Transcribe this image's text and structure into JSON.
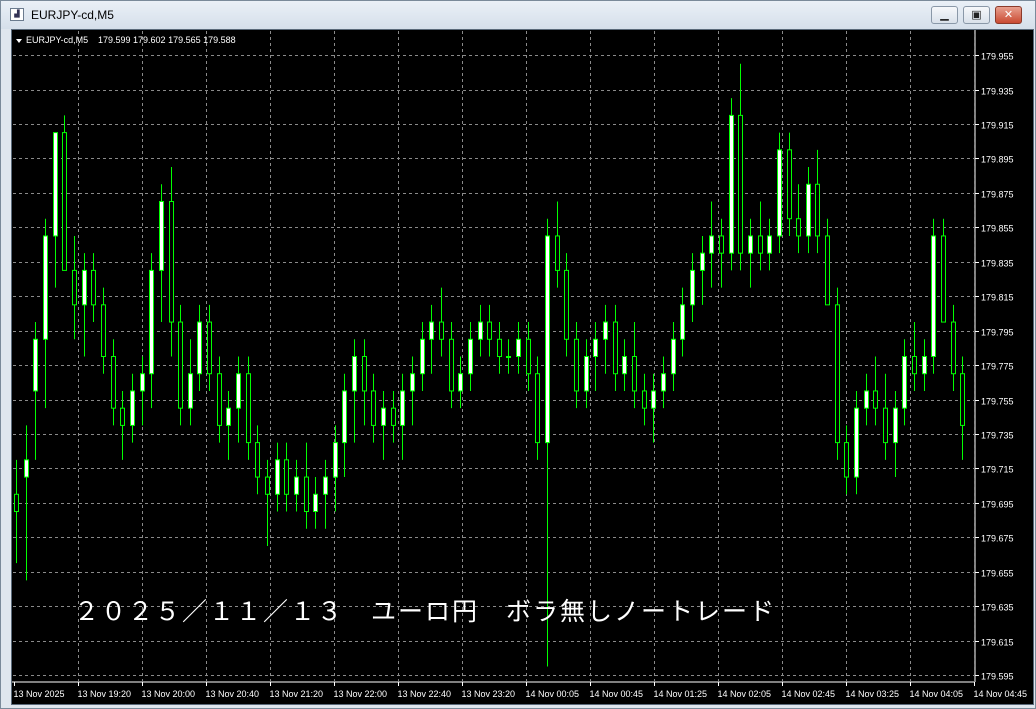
{
  "window": {
    "title": "EURJPY-cd,M5"
  },
  "chart_header": {
    "symbol": "EURJPY-cd,M5",
    "ohlc": "179.599 179.602 179.565 179.588"
  },
  "overlay_text": "２０２５／１１／１３　ユーロ円　ボラ無しノートレード",
  "colors": {
    "background": "#000000",
    "grid": "#8a8a8a",
    "candle_up": "#ffffff",
    "candle_down": "#ffffff",
    "wick": "#00ff00",
    "axis_text": "#ffffff"
  },
  "chart_data": {
    "type": "candlestick",
    "symbol": "EURJPY-cd",
    "timeframe": "M5",
    "y_ticks": [
      "179.955",
      "179.935",
      "179.915",
      "179.895",
      "179.875",
      "179.855",
      "179.835",
      "179.815",
      "179.795",
      "179.775",
      "179.755",
      "179.735",
      "179.715",
      "179.695",
      "179.675",
      "179.655",
      "179.635",
      "179.615",
      "179.595"
    ],
    "ylim": [
      179.591,
      179.969
    ],
    "x_ticks": [
      "13 Nov 2025",
      "13 Nov 19:20",
      "13 Nov 20:00",
      "13 Nov 20:40",
      "13 Nov 21:20",
      "13 Nov 22:00",
      "13 Nov 22:40",
      "13 Nov 23:20",
      "14 Nov 00:05",
      "14 Nov 00:45",
      "14 Nov 01:25",
      "14 Nov 02:05",
      "14 Nov 02:45",
      "14 Nov 03:25",
      "14 Nov 04:05",
      "14 Nov 04:45"
    ],
    "grid": true,
    "candles": [
      {
        "o": 179.7,
        "h": 179.72,
        "l": 179.66,
        "c": 179.69
      },
      {
        "o": 179.71,
        "h": 179.74,
        "l": 179.65,
        "c": 179.72
      },
      {
        "o": 179.76,
        "h": 179.8,
        "l": 179.72,
        "c": 179.79
      },
      {
        "o": 179.79,
        "h": 179.86,
        "l": 179.75,
        "c": 179.85
      },
      {
        "o": 179.85,
        "h": 179.9,
        "l": 179.82,
        "c": 179.91
      },
      {
        "o": 179.91,
        "h": 179.92,
        "l": 179.84,
        "c": 179.83
      },
      {
        "o": 179.83,
        "h": 179.85,
        "l": 179.79,
        "c": 179.81
      },
      {
        "o": 179.81,
        "h": 179.84,
        "l": 179.78,
        "c": 179.83
      },
      {
        "o": 179.83,
        "h": 179.84,
        "l": 179.8,
        "c": 179.81
      },
      {
        "o": 179.81,
        "h": 179.82,
        "l": 179.77,
        "c": 179.78
      },
      {
        "o": 179.78,
        "h": 179.79,
        "l": 179.74,
        "c": 179.75
      },
      {
        "o": 179.75,
        "h": 179.76,
        "l": 179.72,
        "c": 179.74
      },
      {
        "o": 179.74,
        "h": 179.77,
        "l": 179.73,
        "c": 179.76
      },
      {
        "o": 179.76,
        "h": 179.78,
        "l": 179.74,
        "c": 179.77
      },
      {
        "o": 179.77,
        "h": 179.84,
        "l": 179.75,
        "c": 179.83
      },
      {
        "o": 179.83,
        "h": 179.88,
        "l": 179.8,
        "c": 179.87
      },
      {
        "o": 179.87,
        "h": 179.89,
        "l": 179.78,
        "c": 179.8
      },
      {
        "o": 179.8,
        "h": 179.81,
        "l": 179.74,
        "c": 179.75
      },
      {
        "o": 179.75,
        "h": 179.79,
        "l": 179.74,
        "c": 179.77
      },
      {
        "o": 179.77,
        "h": 179.81,
        "l": 179.76,
        "c": 179.8
      },
      {
        "o": 179.8,
        "h": 179.81,
        "l": 179.76,
        "c": 179.77
      },
      {
        "o": 179.77,
        "h": 179.78,
        "l": 179.73,
        "c": 179.74
      },
      {
        "o": 179.74,
        "h": 179.76,
        "l": 179.72,
        "c": 179.75
      },
      {
        "o": 179.75,
        "h": 179.78,
        "l": 179.73,
        "c": 179.77
      },
      {
        "o": 179.77,
        "h": 179.78,
        "l": 179.72,
        "c": 179.73
      },
      {
        "o": 179.73,
        "h": 179.74,
        "l": 179.7,
        "c": 179.71
      },
      {
        "o": 179.71,
        "h": 179.72,
        "l": 179.67,
        "c": 179.7
      },
      {
        "o": 179.7,
        "h": 179.73,
        "l": 179.69,
        "c": 179.72
      },
      {
        "o": 179.72,
        "h": 179.73,
        "l": 179.69,
        "c": 179.7
      },
      {
        "o": 179.7,
        "h": 179.72,
        "l": 179.69,
        "c": 179.71
      },
      {
        "o": 179.71,
        "h": 179.73,
        "l": 179.68,
        "c": 179.69
      },
      {
        "o": 179.69,
        "h": 179.71,
        "l": 179.68,
        "c": 179.7
      },
      {
        "o": 179.7,
        "h": 179.72,
        "l": 179.68,
        "c": 179.71
      },
      {
        "o": 179.71,
        "h": 179.74,
        "l": 179.69,
        "c": 179.73
      },
      {
        "o": 179.73,
        "h": 179.77,
        "l": 179.71,
        "c": 179.76
      },
      {
        "o": 179.76,
        "h": 179.79,
        "l": 179.73,
        "c": 179.78
      },
      {
        "o": 179.78,
        "h": 179.79,
        "l": 179.74,
        "c": 179.76
      },
      {
        "o": 179.76,
        "h": 179.77,
        "l": 179.73,
        "c": 179.74
      },
      {
        "o": 179.74,
        "h": 179.76,
        "l": 179.72,
        "c": 179.75
      },
      {
        "o": 179.75,
        "h": 179.76,
        "l": 179.73,
        "c": 179.74
      },
      {
        "o": 179.74,
        "h": 179.77,
        "l": 179.72,
        "c": 179.76
      },
      {
        "o": 179.76,
        "h": 179.78,
        "l": 179.74,
        "c": 179.77
      },
      {
        "o": 179.77,
        "h": 179.8,
        "l": 179.76,
        "c": 179.79
      },
      {
        "o": 179.79,
        "h": 179.81,
        "l": 179.77,
        "c": 179.8
      },
      {
        "o": 179.8,
        "h": 179.82,
        "l": 179.78,
        "c": 179.79
      },
      {
        "o": 179.79,
        "h": 179.8,
        "l": 179.75,
        "c": 179.76
      },
      {
        "o": 179.76,
        "h": 179.78,
        "l": 179.75,
        "c": 179.77
      },
      {
        "o": 179.77,
        "h": 179.8,
        "l": 179.76,
        "c": 179.79
      },
      {
        "o": 179.79,
        "h": 179.81,
        "l": 179.78,
        "c": 179.8
      },
      {
        "o": 179.8,
        "h": 179.81,
        "l": 179.78,
        "c": 179.79
      },
      {
        "o": 179.79,
        "h": 179.8,
        "l": 179.77,
        "c": 179.78
      },
      {
        "o": 179.78,
        "h": 179.79,
        "l": 179.77,
        "c": 179.78
      },
      {
        "o": 179.78,
        "h": 179.8,
        "l": 179.77,
        "c": 179.79
      },
      {
        "o": 179.79,
        "h": 179.8,
        "l": 179.76,
        "c": 179.77
      },
      {
        "o": 179.77,
        "h": 179.78,
        "l": 179.72,
        "c": 179.73
      },
      {
        "o": 179.73,
        "h": 179.86,
        "l": 179.6,
        "c": 179.85
      },
      {
        "o": 179.85,
        "h": 179.87,
        "l": 179.82,
        "c": 179.83
      },
      {
        "o": 179.83,
        "h": 179.84,
        "l": 179.78,
        "c": 179.79
      },
      {
        "o": 179.79,
        "h": 179.8,
        "l": 179.75,
        "c": 179.76
      },
      {
        "o": 179.76,
        "h": 179.79,
        "l": 179.75,
        "c": 179.78
      },
      {
        "o": 179.78,
        "h": 179.8,
        "l": 179.76,
        "c": 179.79
      },
      {
        "o": 179.79,
        "h": 179.81,
        "l": 179.77,
        "c": 179.8
      },
      {
        "o": 179.8,
        "h": 179.81,
        "l": 179.76,
        "c": 179.77
      },
      {
        "o": 179.77,
        "h": 179.79,
        "l": 179.76,
        "c": 179.78
      },
      {
        "o": 179.78,
        "h": 179.8,
        "l": 179.75,
        "c": 179.76
      },
      {
        "o": 179.76,
        "h": 179.77,
        "l": 179.74,
        "c": 179.75
      },
      {
        "o": 179.75,
        "h": 179.77,
        "l": 179.73,
        "c": 179.76
      },
      {
        "o": 179.76,
        "h": 179.78,
        "l": 179.75,
        "c": 179.77
      },
      {
        "o": 179.77,
        "h": 179.8,
        "l": 179.76,
        "c": 179.79
      },
      {
        "o": 179.79,
        "h": 179.82,
        "l": 179.78,
        "c": 179.81
      },
      {
        "o": 179.81,
        "h": 179.84,
        "l": 179.8,
        "c": 179.83
      },
      {
        "o": 179.83,
        "h": 179.85,
        "l": 179.81,
        "c": 179.84
      },
      {
        "o": 179.84,
        "h": 179.87,
        "l": 179.82,
        "c": 179.85
      },
      {
        "o": 179.85,
        "h": 179.86,
        "l": 179.82,
        "c": 179.84
      },
      {
        "o": 179.84,
        "h": 179.93,
        "l": 179.83,
        "c": 179.92
      },
      {
        "o": 179.92,
        "h": 179.95,
        "l": 179.83,
        "c": 179.84
      },
      {
        "o": 179.84,
        "h": 179.86,
        "l": 179.82,
        "c": 179.85
      },
      {
        "o": 179.85,
        "h": 179.87,
        "l": 179.83,
        "c": 179.84
      },
      {
        "o": 179.84,
        "h": 179.86,
        "l": 179.83,
        "c": 179.85
      },
      {
        "o": 179.85,
        "h": 179.91,
        "l": 179.84,
        "c": 179.9
      },
      {
        "o": 179.9,
        "h": 179.91,
        "l": 179.85,
        "c": 179.86
      },
      {
        "o": 179.86,
        "h": 179.88,
        "l": 179.84,
        "c": 179.85
      },
      {
        "o": 179.85,
        "h": 179.89,
        "l": 179.84,
        "c": 179.88
      },
      {
        "o": 179.88,
        "h": 179.9,
        "l": 179.84,
        "c": 179.85
      },
      {
        "o": 179.85,
        "h": 179.86,
        "l": 179.81,
        "c": 179.81
      },
      {
        "o": 179.81,
        "h": 179.82,
        "l": 179.72,
        "c": 179.73
      },
      {
        "o": 179.73,
        "h": 179.74,
        "l": 179.7,
        "c": 179.71
      },
      {
        "o": 179.71,
        "h": 179.76,
        "l": 179.7,
        "c": 179.75
      },
      {
        "o": 179.75,
        "h": 179.77,
        "l": 179.74,
        "c": 179.76
      },
      {
        "o": 179.76,
        "h": 179.78,
        "l": 179.74,
        "c": 179.75
      },
      {
        "o": 179.75,
        "h": 179.77,
        "l": 179.72,
        "c": 179.73
      },
      {
        "o": 179.73,
        "h": 179.76,
        "l": 179.71,
        "c": 179.75
      },
      {
        "o": 179.75,
        "h": 179.79,
        "l": 179.74,
        "c": 179.78
      },
      {
        "o": 179.78,
        "h": 179.8,
        "l": 179.76,
        "c": 179.77
      },
      {
        "o": 179.77,
        "h": 179.79,
        "l": 179.76,
        "c": 179.78
      },
      {
        "o": 179.78,
        "h": 179.86,
        "l": 179.77,
        "c": 179.85
      },
      {
        "o": 179.85,
        "h": 179.86,
        "l": 179.8,
        "c": 179.8
      },
      {
        "o": 179.8,
        "h": 179.81,
        "l": 179.76,
        "c": 179.77
      },
      {
        "o": 179.77,
        "h": 179.78,
        "l": 179.72,
        "c": 179.74
      }
    ]
  }
}
